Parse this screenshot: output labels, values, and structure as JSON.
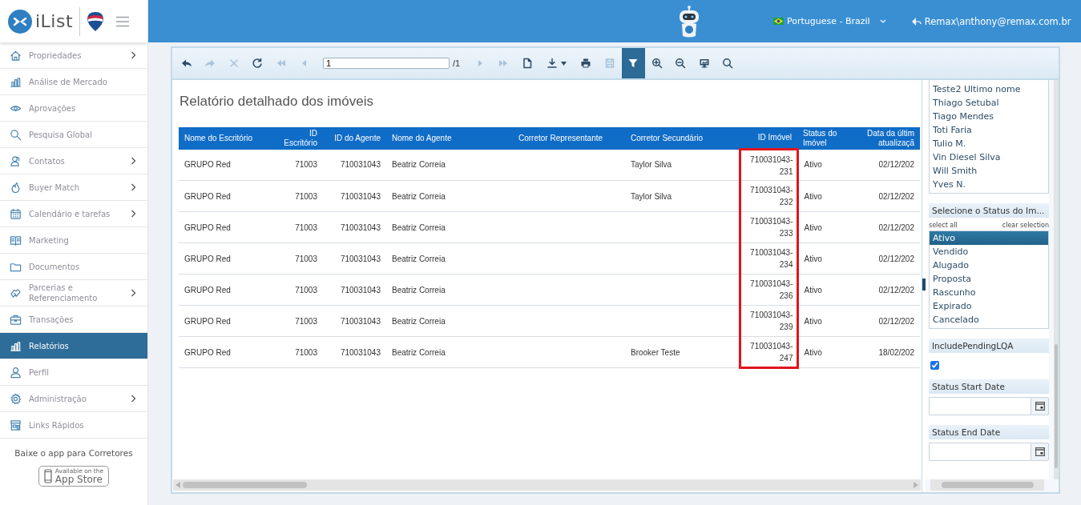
{
  "app": {
    "logo_text": "iList"
  },
  "header": {
    "language": "Portuguese - Brazil",
    "user": "Remax\\anthony@remax.com.br"
  },
  "sidebar": {
    "items": [
      {
        "label": "Propriedades",
        "expandable": true,
        "selected": false
      },
      {
        "label": "Análise de Mercado",
        "expandable": false,
        "selected": false
      },
      {
        "label": "Aprovações",
        "expandable": false,
        "selected": false
      },
      {
        "label": "Pesquisa Global",
        "expandable": false,
        "selected": false
      },
      {
        "label": "Contatos",
        "expandable": true,
        "selected": false
      },
      {
        "label": "Buyer Match",
        "expandable": true,
        "selected": false
      },
      {
        "label": "Calendário e tarefas",
        "expandable": true,
        "selected": false
      },
      {
        "label": "Marketing",
        "expandable": false,
        "selected": false
      },
      {
        "label": "Documentos",
        "expandable": false,
        "selected": false
      },
      {
        "label": "Parcerias e Referenciamento",
        "expandable": true,
        "selected": false
      },
      {
        "label": "Transações",
        "expandable": false,
        "selected": false
      },
      {
        "label": "Relatórios",
        "expandable": false,
        "selected": true
      },
      {
        "label": "Perfil",
        "expandable": false,
        "selected": false
      },
      {
        "label": "Administração",
        "expandable": true,
        "selected": false
      },
      {
        "label": "Links Rápidos",
        "expandable": false,
        "selected": false
      }
    ],
    "promo": "Baixe o app para Corretores",
    "badge": {
      "small": "Available on the",
      "large": "App Store"
    }
  },
  "toolbar": {
    "items": [
      {
        "kind": "button",
        "disabled": false,
        "selected": false
      },
      {
        "kind": "button",
        "disabled": true,
        "selected": false
      },
      {
        "kind": "button",
        "disabled": true,
        "selected": false
      },
      {
        "kind": "button",
        "disabled": false,
        "selected": false
      },
      {
        "kind": "button",
        "disabled": true,
        "selected": false
      },
      {
        "kind": "button",
        "disabled": true,
        "selected": false
      },
      {
        "kind": "page",
        "value": "1",
        "total": "/1"
      },
      {
        "kind": "button",
        "disabled": true,
        "selected": false
      },
      {
        "kind": "button",
        "disabled": true,
        "selected": false
      },
      {
        "kind": "button",
        "disabled": false,
        "selected": false
      },
      {
        "kind": "button",
        "disabled": false,
        "selected": false,
        "has_menu": true
      },
      {
        "kind": "button",
        "disabled": false,
        "selected": false
      },
      {
        "kind": "button",
        "disabled": true,
        "selected": false
      },
      {
        "kind": "button",
        "disabled": false,
        "selected": true
      },
      {
        "kind": "button",
        "disabled": false,
        "selected": false
      },
      {
        "kind": "button",
        "disabled": false,
        "selected": false
      },
      {
        "kind": "button",
        "disabled": false,
        "selected": false
      },
      {
        "kind": "button",
        "disabled": false,
        "selected": false
      }
    ]
  },
  "report": {
    "title": "Relatório detalhado dos imóveis",
    "table": {
      "columns": [
        {
          "label": "Nome do Escritório",
          "highlighted": false
        },
        {
          "label": "ID Escritório",
          "highlighted": false
        },
        {
          "label": "ID do Agente",
          "highlighted": false
        },
        {
          "label": "Nome do Agente",
          "highlighted": false
        },
        {
          "label": "Corretor Representante",
          "highlighted": false
        },
        {
          "label": "Corretor Secundário",
          "highlighted": false
        },
        {
          "label": "ID Imóvel",
          "highlighted": true
        },
        {
          "label": "Status do Imóvel",
          "highlighted": false
        },
        {
          "label": "Data da últim atualizaçã",
          "highlighted": false
        }
      ],
      "rows": [
        [
          "GRUPO Red",
          "71003",
          "710031043",
          "Beatriz Correia",
          null,
          "Taylor Silva",
          "710031043-231",
          "Ativo",
          "02/12/202"
        ],
        [
          "GRUPO Red",
          "71003",
          "710031043",
          "Beatriz Correia",
          null,
          "Taylor Silva",
          "710031043-232",
          "Ativo",
          "02/12/202"
        ],
        [
          "GRUPO Red",
          "71003",
          "710031043",
          "Beatriz Correia",
          null,
          null,
          "710031043-233",
          "Ativo",
          "02/12/202"
        ],
        [
          "GRUPO Red",
          "71003",
          "710031043",
          "Beatriz Correia",
          null,
          null,
          "710031043-234",
          "Ativo",
          "02/12/202"
        ],
        [
          "GRUPO Red",
          "71003",
          "710031043",
          "Beatriz Correia",
          null,
          null,
          "710031043-236",
          "Ativo",
          "02/12/202"
        ],
        [
          "GRUPO Red",
          "71003",
          "710031043",
          "Beatriz Correia",
          null,
          null,
          "710031043-239",
          "Ativo",
          "02/12/202"
        ],
        [
          "GRUPO Red",
          "71003",
          "710031043",
          "Beatriz Correia",
          null,
          "Brooker Teste",
          "710031043-247",
          "Ativo",
          "18/02/202"
        ]
      ]
    }
  },
  "parameters": {
    "agents": [
      "Teste2 Ultimo nome",
      "Thiago Setubal",
      "Tiago Mendes",
      "Toti Faria",
      "Tulio M.",
      "Vin Diesel Silva",
      "Will Smith",
      "Yves N."
    ],
    "status_filter": {
      "title": "Selecione o Status do Im...",
      "select_all": "select all",
      "clear": "clear selection",
      "options": [
        {
          "label": "Ativo",
          "selected": true
        },
        {
          "label": "Vendido",
          "selected": false
        },
        {
          "label": "Alugado",
          "selected": false
        },
        {
          "label": "Proposta",
          "selected": false
        },
        {
          "label": "Rascunho",
          "selected": false
        },
        {
          "label": "Expirado",
          "selected": false
        },
        {
          "label": "Cancelado",
          "selected": false
        }
      ]
    },
    "include_pending": {
      "title": "IncludePendingLQA",
      "checked": true
    },
    "dates": [
      {
        "title": "Status Start Date"
      },
      {
        "title": "Status End Date"
      }
    ]
  }
}
